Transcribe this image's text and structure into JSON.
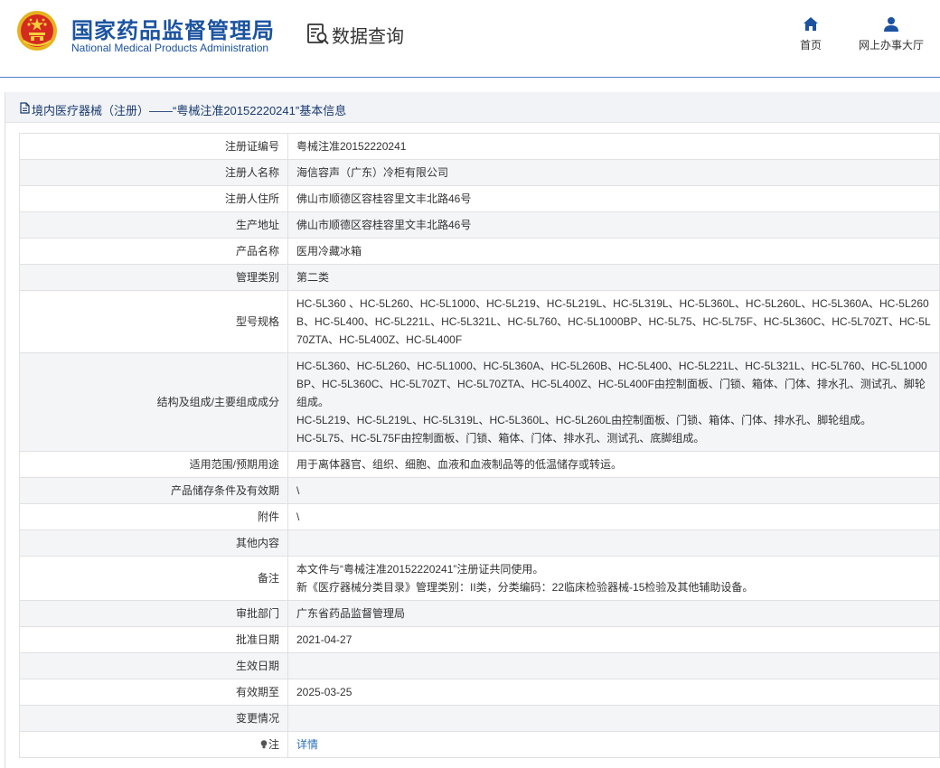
{
  "header": {
    "site_name_cn": "国家药品监督管理局",
    "site_name_en": "National Medical Products Administration",
    "section_title": "数据查询",
    "nav": [
      {
        "label": "首页",
        "icon": "home-icon"
      },
      {
        "label": "网上办事大厅",
        "icon": "user-icon"
      }
    ]
  },
  "panel": {
    "title": "境内医疗器械（注册）——“粤械注准20152220241”基本信息"
  },
  "rows": [
    {
      "label": "注册证编号",
      "value": "粤械注准20152220241"
    },
    {
      "label": "注册人名称",
      "value": "海信容声（广东）冷柜有限公司"
    },
    {
      "label": "注册人住所",
      "value": "佛山市顺德区容桂容里文丰北路46号"
    },
    {
      "label": "生产地址",
      "value": "佛山市顺德区容桂容里文丰北路46号"
    },
    {
      "label": "产品名称",
      "value": "医用冷藏冰箱"
    },
    {
      "label": "管理类别",
      "value": "第二类"
    },
    {
      "label": "型号规格",
      "value": "HC-5L360 、HC-5L260、HC-5L1000、HC-5L219、HC-5L219L、HC-5L319L、HC-5L360L、HC-5L260L、HC-5L360A、HC-5L260B、HC-5L400、HC-5L221L、HC-5L321L、HC-5L760、HC-5L1000BP、HC-5L75、HC-5L75F、HC-5L360C、HC-5L70ZT、HC-5L70ZTA、HC-5L400Z、HC-5L400F"
    },
    {
      "label": "结构及组成/主要组成成分",
      "lines": [
        "HC-5L360、HC-5L260、HC-5L1000、HC-5L360A、HC-5L260B、HC-5L400、HC-5L221L、HC-5L321L、HC-5L760、HC-5L1000BP、HC-5L360C、HC-5L70ZT、HC-5L70ZTA、HC-5L400Z、HC-5L400F由控制面板、门锁、箱体、门体、排水孔、测试孔、脚轮组成。",
        "HC-5L219、HC-5L219L、HC-5L319L、HC-5L360L、HC-5L260L由控制面板、门锁、箱体、门体、排水孔、脚轮组成。",
        "HC-5L75、HC-5L75F由控制面板、门锁、箱体、门体、排水孔、测试孔、底脚组成。"
      ]
    },
    {
      "label": "适用范围/预期用途",
      "value": "用于离体器官、组织、细胞、血液和血液制品等的低温储存或转运。"
    },
    {
      "label": "产品储存条件及有效期",
      "value": "\\"
    },
    {
      "label": "附件",
      "value": "\\"
    },
    {
      "label": "其他内容",
      "value": ""
    },
    {
      "label": "备注",
      "lines": [
        "本文件与“粤械注准20152220241”注册证共同使用。",
        "新《医疗器械分类目录》管理类别：II类，分类编码：22临床检验器械-15检验及其他辅助设备。"
      ]
    },
    {
      "label": "审批部门",
      "value": "广东省药品监督管理局"
    },
    {
      "label": "批准日期",
      "value": "2021-04-27"
    },
    {
      "label": "生效日期",
      "value": ""
    },
    {
      "label": "有效期至",
      "value": "2025-03-25"
    },
    {
      "label": "变更情况",
      "value": ""
    }
  ],
  "note_row": {
    "label": "注",
    "icon": "lightbulb-icon",
    "link": "详情"
  },
  "colors": {
    "brand": "#1b53a0",
    "link": "#2a6ebb",
    "row_alt": "#f4f5f7"
  }
}
